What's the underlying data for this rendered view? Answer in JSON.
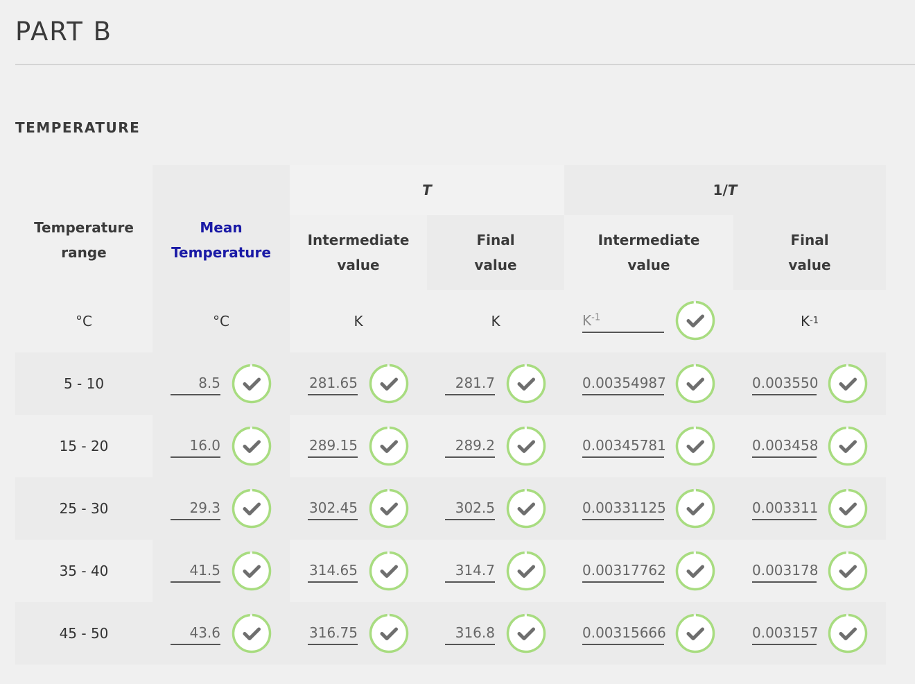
{
  "page": {
    "title": "PART B",
    "section": "TEMPERATURE"
  },
  "headers": {
    "range": "Temperature range",
    "mean": "Mean Temperature",
    "T": "T",
    "invT_prefix": "1/",
    "invT_var": "T",
    "intermediate": "Intermediate value",
    "final": "Final value"
  },
  "units": {
    "range": "°C",
    "mean": "°C",
    "t_int": "K",
    "t_fin": "K",
    "inv_base": "K",
    "inv_exp": "-1"
  },
  "rows": [
    {
      "range": "5 - 10",
      "mean": "8.5",
      "t_int": "281.65",
      "t_fin": "281.7",
      "inv_int": "0.00354987",
      "inv_fin": "0.003550"
    },
    {
      "range": "15 - 20",
      "mean": "16.0",
      "t_int": "289.15",
      "t_fin": "289.2",
      "inv_int": "0.00345781",
      "inv_fin": "0.003458"
    },
    {
      "range": "25 - 30",
      "mean": "29.3",
      "t_int": "302.45",
      "t_fin": "302.5",
      "inv_int": "0.00331125",
      "inv_fin": "0.003311"
    },
    {
      "range": "35 - 40",
      "mean": "41.5",
      "t_int": "314.65",
      "t_fin": "314.7",
      "inv_int": "0.00317762",
      "inv_fin": "0.003178"
    },
    {
      "range": "45 - 50",
      "mean": "43.6",
      "t_int": "316.75",
      "t_fin": "316.8",
      "inv_int": "0.00315666",
      "inv_fin": "0.003157"
    }
  ],
  "colors": {
    "check_ring": "#a8dc80",
    "check_mark": "#6e6e6e",
    "header_blue": "#1a1aa6"
  },
  "icons": {
    "check": "check-circle-icon"
  }
}
